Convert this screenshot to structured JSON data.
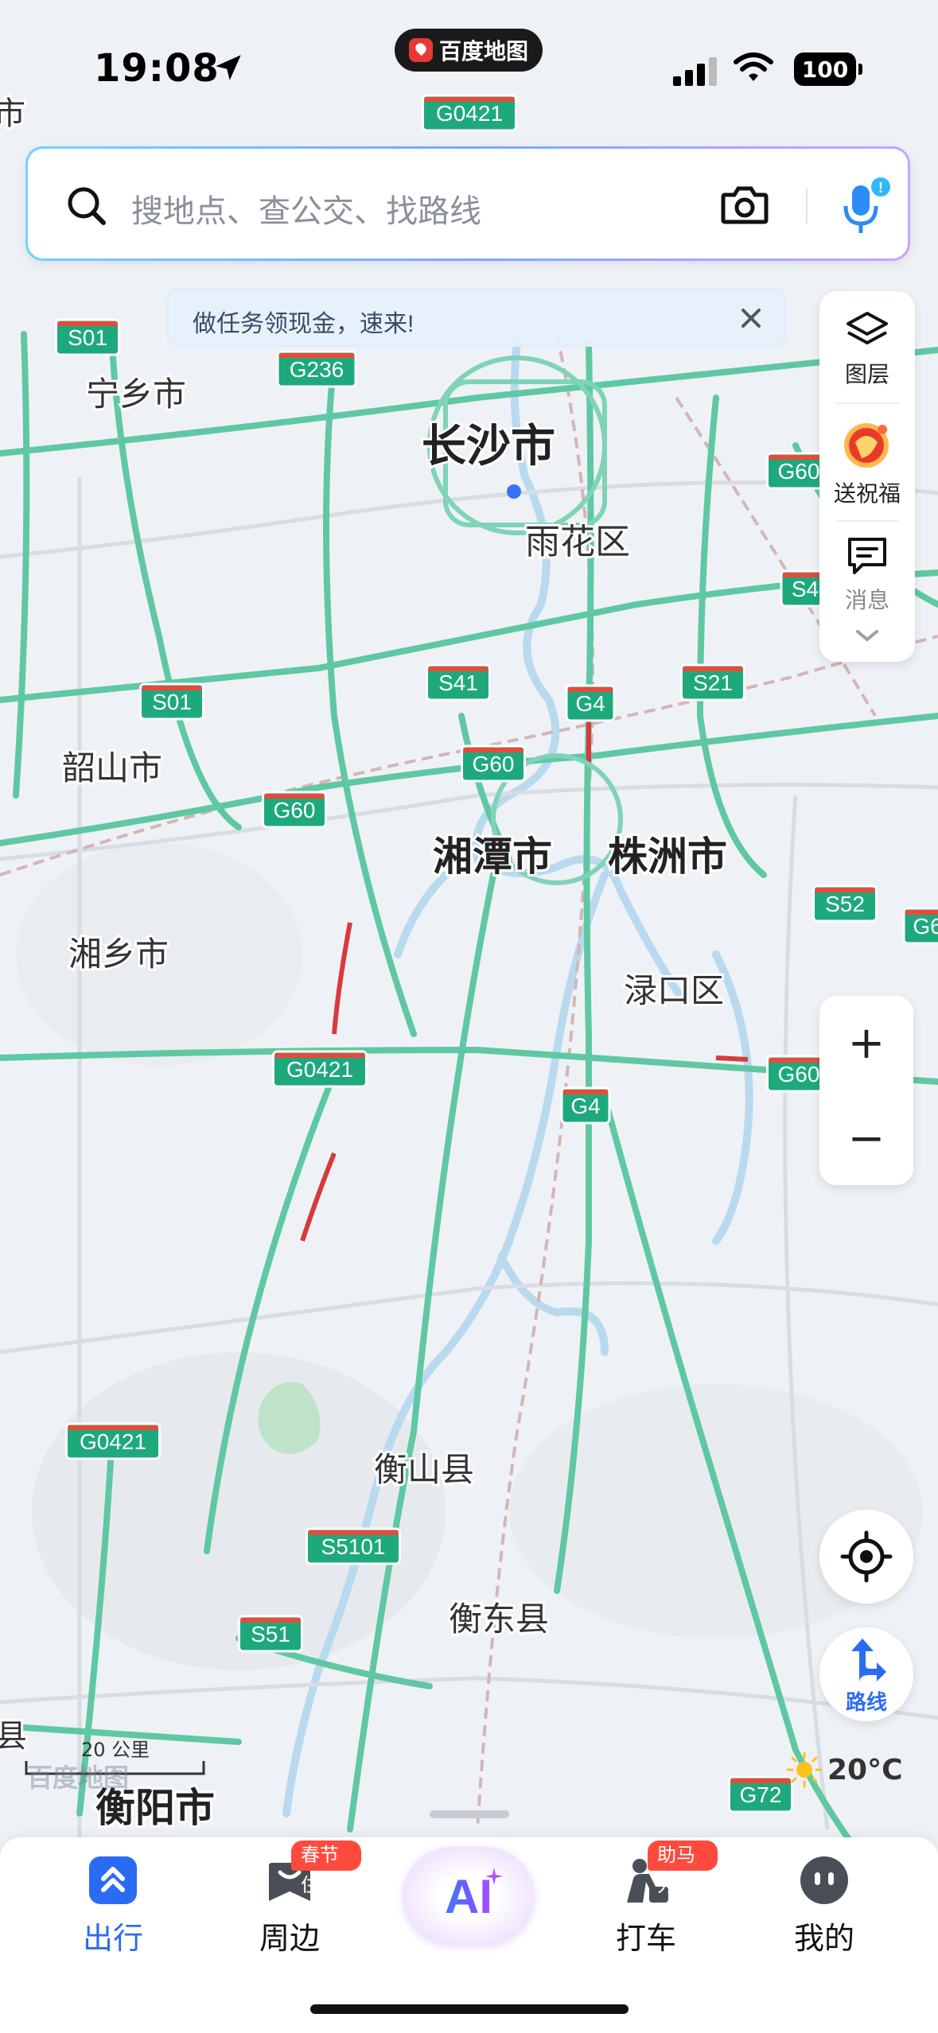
{
  "status_bar": {
    "time": "19:08",
    "app_name": "百度地图",
    "battery": "100"
  },
  "search": {
    "placeholder": "搜地点、查公交、找路线"
  },
  "banner": {
    "text": "做任务领现金，速来!"
  },
  "side_panel": {
    "items": [
      {
        "label": "图层",
        "icon": "layers-icon"
      },
      {
        "label": "送祝福",
        "icon": "blessing-icon"
      },
      {
        "label": "消息",
        "icon": "message-icon"
      }
    ]
  },
  "map": {
    "cities": [
      {
        "name": "长沙市"
      },
      {
        "name": "雨花区"
      },
      {
        "name": "宁乡市"
      },
      {
        "name": "韶山市"
      },
      {
        "name": "湘潭市"
      },
      {
        "name": "株洲市"
      },
      {
        "name": "湘乡市"
      },
      {
        "name": "渌口区"
      },
      {
        "name": "衡山县"
      },
      {
        "name": "衡东县"
      },
      {
        "name": "衡阳市"
      },
      {
        "name": "县"
      },
      {
        "name": "市"
      }
    ],
    "road_shields": [
      "G0421",
      "S01",
      "G236",
      "G60",
      "S4",
      "S41",
      "G4",
      "S21",
      "S01",
      "G60",
      "G60",
      "S52",
      "G6",
      "G0421",
      "G4",
      "G60",
      "G0421",
      "S5101",
      "S51",
      "G72"
    ],
    "scale": "20 公里",
    "watermark": "百度地图"
  },
  "weather": {
    "temp": "20°C"
  },
  "route_button": {
    "label": "路线"
  },
  "zoom": {
    "in": "+",
    "out": "−"
  },
  "tabs": [
    {
      "label": "出行",
      "active": true
    },
    {
      "label": "周边",
      "badge": "春节住"
    },
    {
      "label": "AI",
      "ai": true
    },
    {
      "label": "打车",
      "badge": "助马力"
    },
    {
      "label": "我的"
    }
  ],
  "colors": {
    "accent": "#2b6bf3",
    "highway_green": "#1ea97c",
    "badge_red": "#ff4a3d"
  }
}
